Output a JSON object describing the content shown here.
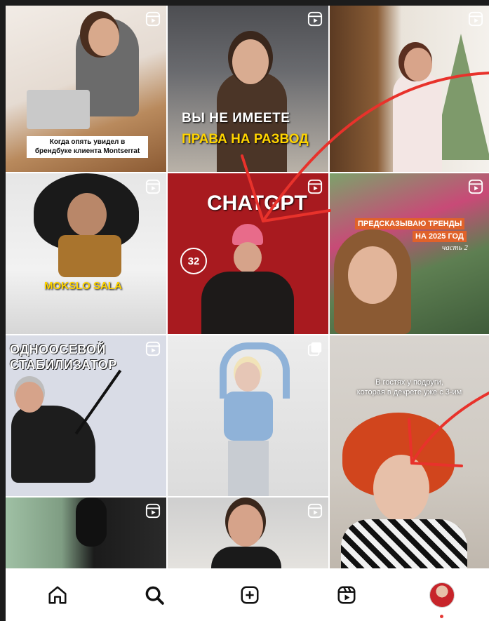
{
  "grid": {
    "tiles": [
      {
        "id": "t1",
        "caption_lines": [
          "Когда опять увидел в",
          "брендбуке клиента Montserrat"
        ],
        "type": "reel"
      },
      {
        "id": "t2",
        "caption_white": "ВЫ НЕ ИМЕЕТЕ",
        "caption_yellow": "ПРАВА НА РАЗВОД",
        "type": "reel"
      },
      {
        "id": "t3",
        "type": "reel"
      },
      {
        "id": "t4",
        "caption_yellow": "MOKSLO SALA",
        "type": "reel"
      },
      {
        "id": "t5",
        "caption_white": "CHATGPT",
        "badge": "32",
        "type": "reel"
      },
      {
        "id": "t6",
        "caption_band_1": "ПРЕДСКАЗЫВАЮ ТРЕНДЫ",
        "caption_band_2": "НА 2025 ГОД",
        "caption_sub": "часть 2",
        "type": "reel"
      },
      {
        "id": "t7",
        "caption_white_1": "ОДНООСЕВОЙ",
        "caption_white_2": "СТАБИЛИЗАТОР",
        "type": "reel"
      },
      {
        "id": "t8",
        "type": "multi"
      },
      {
        "id": "t9",
        "caption_lines": [
          "В гостях у подруги,",
          "которая в декрете уже с 3-им"
        ],
        "type": "none"
      },
      {
        "id": "t10",
        "type": "reel"
      },
      {
        "id": "t11",
        "type": "reel"
      }
    ]
  },
  "nav": {
    "items": [
      "home-icon",
      "search-icon",
      "create-icon",
      "reels-icon",
      "profile-avatar"
    ],
    "active": "search",
    "accent": "#e53935"
  },
  "colors": {
    "arrow": "#e8322b",
    "chatgpt_bg": "#a81a1f",
    "trend_band": "#e0622a",
    "caption_yellow": "#ffd400"
  }
}
